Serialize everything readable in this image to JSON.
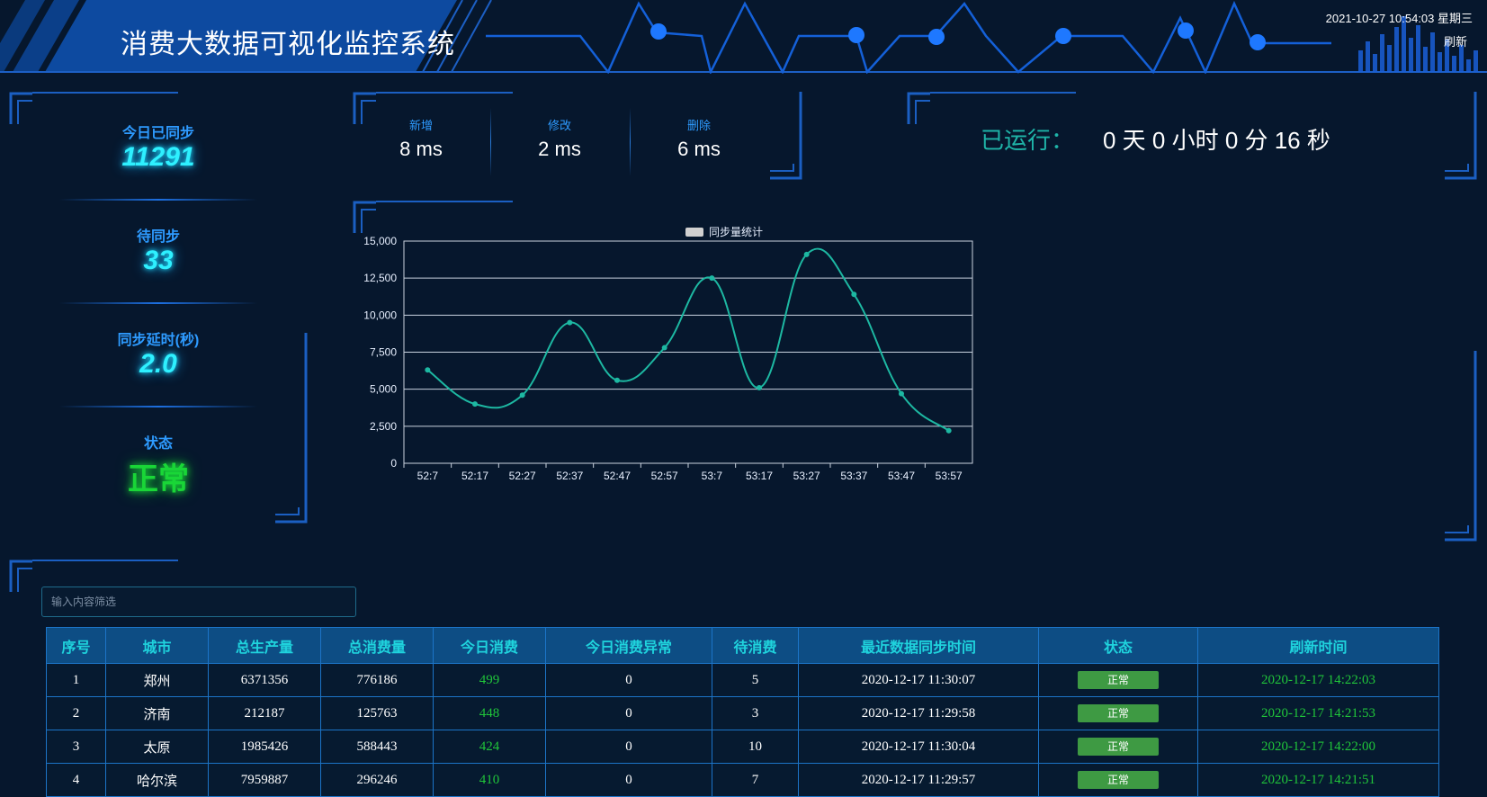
{
  "header": {
    "title": "消费大数据可视化监控系统",
    "datetime": "2021-10-27 10:54:03 星期三",
    "refresh_label": "刷新"
  },
  "stats": [
    {
      "label": "今日已同步",
      "value": "11291"
    },
    {
      "label": "待同步",
      "value": "33"
    },
    {
      "label": "同步延时(秒)",
      "value": "2.0"
    },
    {
      "label": "状态",
      "value": "正常"
    }
  ],
  "timings": [
    {
      "label": "新增",
      "value": "8 ms"
    },
    {
      "label": "修改",
      "value": "2 ms"
    },
    {
      "label": "删除",
      "value": "6 ms"
    }
  ],
  "uptime": {
    "label": "已运行：",
    "value": "0 天 0 小时 0 分 16 秒"
  },
  "chart_data": {
    "type": "line",
    "legend": "同步量统计",
    "x": [
      "52:7",
      "52:17",
      "52:27",
      "52:37",
      "52:47",
      "52:57",
      "53:7",
      "53:17",
      "53:27",
      "53:37",
      "53:47",
      "53:57"
    ],
    "series": [
      {
        "name": "同步量统计",
        "values": [
          6300,
          4000,
          4600,
          9500,
          5600,
          7800,
          12500,
          5100,
          14100,
          11400,
          4700,
          2200
        ]
      }
    ],
    "ylim": [
      0,
      15000
    ],
    "yticks": [
      "0",
      "2,500",
      "5,000",
      "7,500",
      "10,000",
      "12,500",
      "15,000"
    ],
    "line_color": "#1db8a2",
    "grid": true
  },
  "filter": {
    "placeholder": "输入内容筛选",
    "value": ""
  },
  "table": {
    "headers": [
      "序号",
      "城市",
      "总生产量",
      "总消费量",
      "今日消费",
      "今日消费异常",
      "待消费",
      "最近数据同步时间",
      "状态",
      "刷新时间"
    ],
    "rows": [
      [
        "1",
        "郑州",
        "6371356",
        "776186",
        "499",
        "0",
        "5",
        "2020-12-17 11:30:07",
        "正常",
        "2020-12-17 14:22:03"
      ],
      [
        "2",
        "济南",
        "212187",
        "125763",
        "448",
        "0",
        "3",
        "2020-12-17 11:29:58",
        "正常",
        "2020-12-17 14:21:53"
      ],
      [
        "3",
        "太原",
        "1985426",
        "588443",
        "424",
        "0",
        "10",
        "2020-12-17 11:30:04",
        "正常",
        "2020-12-17 14:22:00"
      ],
      [
        "4",
        "哈尔滨",
        "7959887",
        "296246",
        "410",
        "0",
        "7",
        "2020-12-17 11:29:57",
        "正常",
        "2020-12-17 14:21:51"
      ]
    ]
  },
  "colors": {
    "background": "#06172d",
    "accent_blue": "#2e9bff",
    "cyan": "#2ef0ff",
    "status_green": "#3e9a43",
    "table_header_bg": "#0d4d84"
  }
}
